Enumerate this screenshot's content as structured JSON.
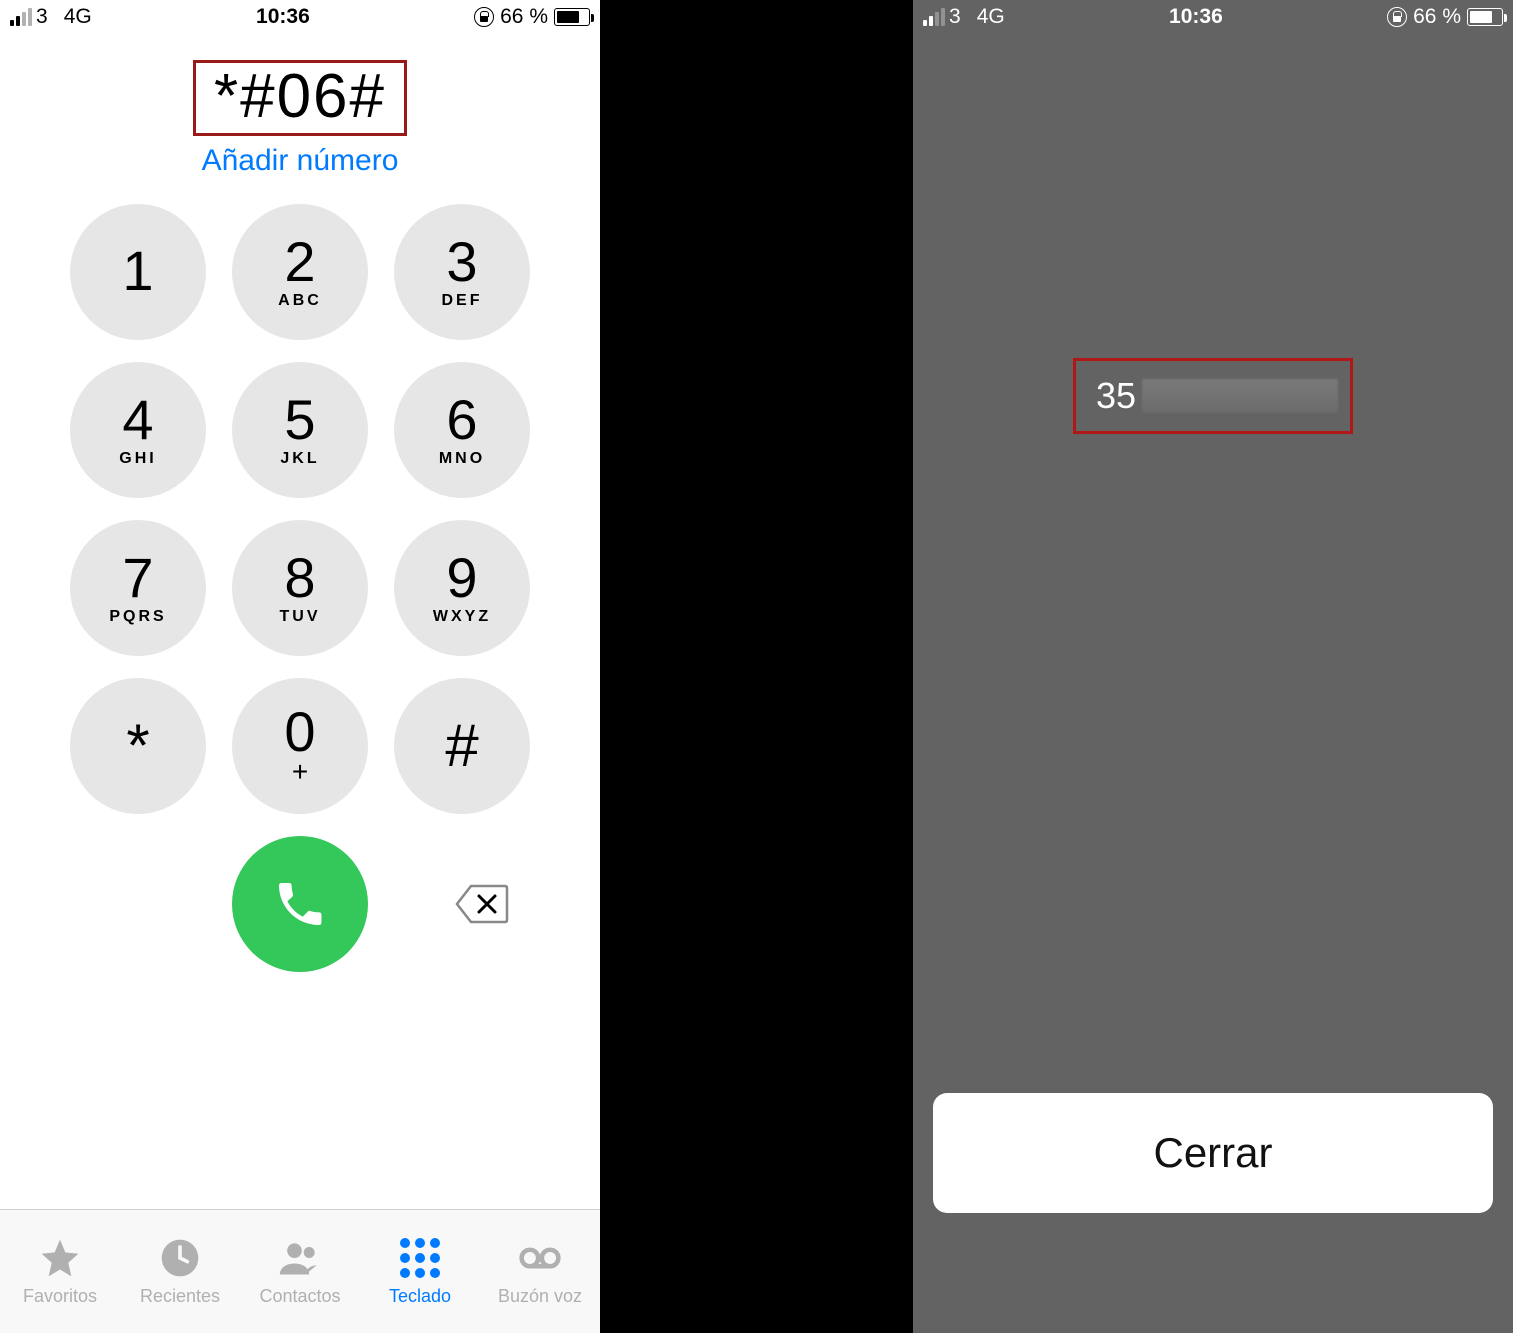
{
  "status": {
    "carrier_number": "3",
    "network": "4G",
    "time": "10:36",
    "battery_percent": "66 %"
  },
  "dialer": {
    "dialed_number": "*#06#",
    "add_number_label": "Añadir número",
    "keys": [
      {
        "digit": "1",
        "letters": ""
      },
      {
        "digit": "2",
        "letters": "ABC"
      },
      {
        "digit": "3",
        "letters": "DEF"
      },
      {
        "digit": "4",
        "letters": "GHI"
      },
      {
        "digit": "5",
        "letters": "JKL"
      },
      {
        "digit": "6",
        "letters": "MNO"
      },
      {
        "digit": "7",
        "letters": "PQRS"
      },
      {
        "digit": "8",
        "letters": "TUV"
      },
      {
        "digit": "9",
        "letters": "WXYZ"
      },
      {
        "digit": "*",
        "letters": ""
      },
      {
        "digit": "0",
        "letters": "+"
      },
      {
        "digit": "#",
        "letters": ""
      }
    ]
  },
  "tabs": {
    "favorites": "Favoritos",
    "recents": "Recientes",
    "contacts": "Contactos",
    "keypad": "Teclado",
    "voicemail": "Buzón voz"
  },
  "result": {
    "imei_visible_prefix": "35",
    "close_label": "Cerrar"
  }
}
